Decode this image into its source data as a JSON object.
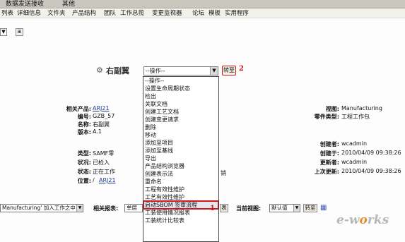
{
  "topbar": {
    "tabs": [
      "数据发送接收",
      "其他"
    ]
  },
  "menu": {
    "items": [
      "列表",
      "详细信息",
      "文件夹",
      "产品结构",
      "团队",
      "工作总揽",
      "变更监视器",
      "论坛",
      "模板",
      "实用程序"
    ]
  },
  "toolbar": {
    "select_glyph": "▼",
    "icon_glyph": "⊞"
  },
  "object": {
    "title": "右副翼"
  },
  "actions": {
    "selected": "--操作--",
    "go_label": "转至",
    "callout_go": "2",
    "callout_item": "1",
    "options": [
      "--操作--",
      "设置生命周期状态",
      "检出",
      "关联文档",
      "创建工艺文档",
      "创建变更请求",
      "删除",
      "移动",
      "添加至项目",
      "添加至基线",
      "导出",
      "产品结构浏览器",
      "创建表示法",
      "重命名",
      "工程有效性维护",
      "工艺有效性维护",
      "启动SBOM 签审流程",
      "工装使用情况报表",
      "工装统计比较表"
    ],
    "highlighted_index": 16
  },
  "left_fields": {
    "related_product": {
      "label": "相关产品:",
      "value": "ARJ21"
    },
    "number": {
      "label": "编号:",
      "value": "GZB_57"
    },
    "name": {
      "label": "名称:",
      "value": "右副翼"
    },
    "version": {
      "label": "版本:",
      "value": "A.1"
    },
    "type": {
      "label": "类型:",
      "value": "SAMF零"
    },
    "status": {
      "label": "状况:",
      "value": "已检入"
    },
    "state": {
      "label": "状态:",
      "value": "正在工作"
    },
    "location": {
      "label": "位置:",
      "value_prefix": "/",
      "value": "ARJ21"
    }
  },
  "right_fields": {
    "view": {
      "label": "视图:",
      "value": "Manufacturing"
    },
    "part_type": {
      "label": "零件类型:",
      "value": "工程工作包"
    },
    "creator": {
      "label": "创建者:",
      "value": "wcadmin"
    },
    "created": {
      "label": "创建于:",
      "value": "2010/04/09 09:38:26"
    },
    "updater": {
      "label": "更新者:",
      "value": "wcadmin"
    },
    "updated": {
      "label": "上次更新:",
      "value": "2010/04/09 09:38:26"
    }
  },
  "state_tail": "销",
  "bottom": {
    "view_select": "Manufacturing' 加入工作之中",
    "related_report_label": "相关报表:",
    "report_select": "单层",
    "report_btn": "表",
    "current_view_label": "当前视图:",
    "current_view_value": "默认值",
    "go_label": "转至",
    "grid_glyph": "▦"
  },
  "watermark": {
    "e": "e",
    "dash": "-",
    "w": "w",
    "o": "o",
    "rks": "rks"
  }
}
